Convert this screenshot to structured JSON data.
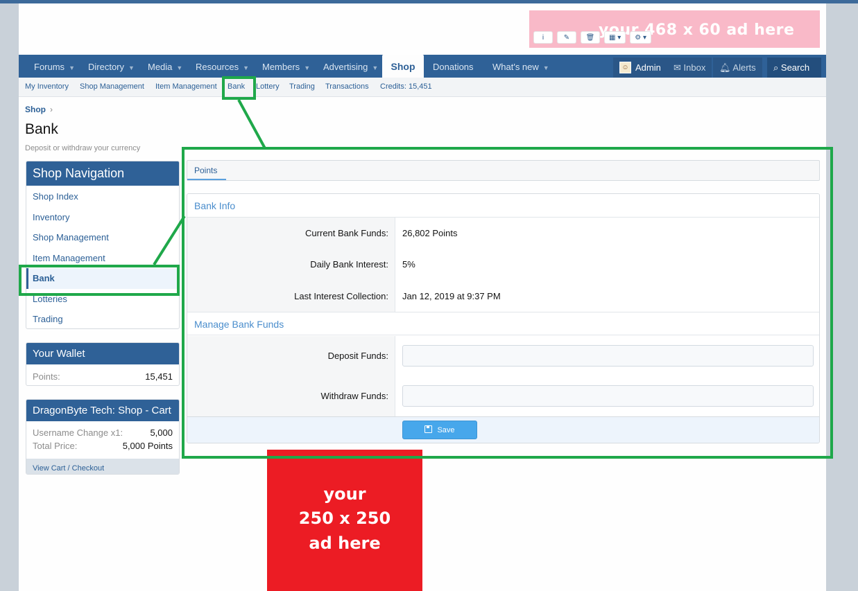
{
  "ad_top": {
    "text": "your 468 x 60 ad here",
    "tools": [
      "i",
      "✎",
      "🗑",
      "▦ ▾",
      "⚙ ▾"
    ]
  },
  "nav": {
    "items": [
      {
        "label": "Forums",
        "caret": "▼"
      },
      {
        "label": "Directory",
        "caret": "▼"
      },
      {
        "label": "Media",
        "caret": "▼"
      },
      {
        "label": "Resources",
        "caret": "▼"
      },
      {
        "label": "Members",
        "caret": "▼"
      },
      {
        "label": "Advertising",
        "caret": "▼"
      },
      {
        "label": "Shop",
        "caret": ""
      },
      {
        "label": "Donations",
        "caret": ""
      },
      {
        "label": "What's new",
        "caret": "▼"
      }
    ],
    "admin": "Admin",
    "inbox": "Inbox",
    "alerts": "Alerts",
    "search": "Search"
  },
  "subnav": [
    "My Inventory",
    "Shop Management",
    "Item Management",
    "Bank",
    "Lottery",
    "Trading",
    "Transactions",
    "Credits: 15,451"
  ],
  "breadcrumb": {
    "label": "Shop",
    "sep": "›"
  },
  "page": {
    "title": "Bank",
    "description": "Deposit or withdraw your currency"
  },
  "sidebar": {
    "nav_title": "Shop Navigation",
    "nav_items": [
      "Shop Index",
      "Inventory",
      "Shop Management",
      "Item Management",
      "Bank",
      "Lotteries",
      "Trading"
    ],
    "selected": "Bank",
    "wallet_title": "Your Wallet",
    "wallet_label": "Points:",
    "wallet_value": "15,451",
    "cart_title": "DragonByte Tech: Shop - Cart",
    "cart_rows": [
      {
        "label": "Username Change x1:",
        "value": "5,000"
      },
      {
        "label": "Total Price:",
        "value": "5,000 Points"
      }
    ],
    "cart_footer": "View Cart / Checkout"
  },
  "main": {
    "tab": "Points",
    "bank_info_title": "Bank Info",
    "rows": [
      {
        "label": "Current Bank Funds:",
        "value": "26,802 Points"
      },
      {
        "label": "Daily Bank Interest:",
        "value": "5%"
      },
      {
        "label": "Last Interest Collection:",
        "value": "Jan 12, 2019 at 9:37 PM"
      }
    ],
    "manage_title": "Manage Bank Funds",
    "deposit_label": "Deposit Funds:",
    "withdraw_label": "Withdraw Funds:",
    "deposit_value": "",
    "withdraw_value": "",
    "save_label": "Save"
  },
  "ad_side": {
    "lines": [
      "your",
      "250 x 250",
      "ad here"
    ]
  },
  "colors": {
    "nav": "#2f6197",
    "link": "#2b5f96",
    "highlight": "#1fa84a",
    "save": "#47a7eb",
    "ad_side": "#ec1c24",
    "ad_top": "#f9b9c8"
  }
}
